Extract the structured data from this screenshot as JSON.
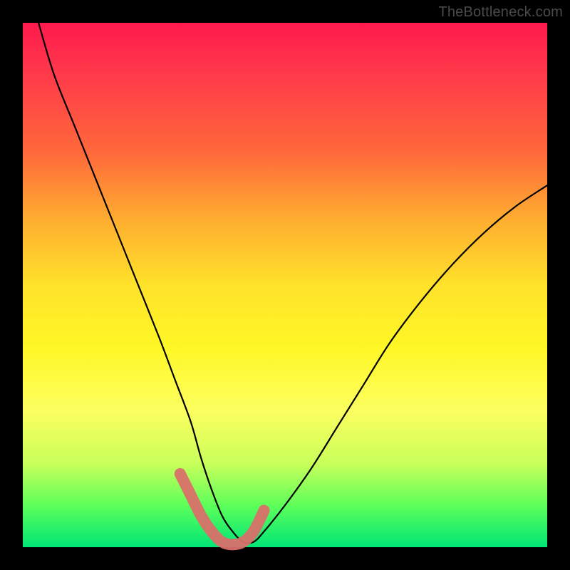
{
  "watermark": "TheBottleneck.com",
  "chart_data": {
    "type": "line",
    "title": "",
    "xlabel": "",
    "ylabel": "",
    "xlim": [
      0,
      100
    ],
    "ylim": [
      0,
      100
    ],
    "series": [
      {
        "name": "bottleneck-curve",
        "x": [
          3,
          6,
          10,
          14,
          18,
          22,
          26,
          29,
          32,
          34,
          36,
          38,
          40,
          42,
          44,
          46,
          50,
          55,
          60,
          65,
          70,
          76,
          82,
          88,
          94,
          100
        ],
        "values": [
          100,
          90,
          80,
          70,
          60,
          50,
          40,
          32,
          24,
          17,
          11,
          6,
          3,
          1,
          1,
          3,
          8,
          15,
          23,
          31,
          39,
          47,
          54,
          60,
          65,
          69
        ]
      }
    ],
    "highlight": {
      "name": "optimal-band",
      "x_range": [
        30,
        46
      ],
      "x": [
        30,
        32,
        34,
        36,
        38,
        40,
        42,
        44,
        46
      ],
      "values": [
        14,
        10,
        6,
        3,
        1,
        0.5,
        1,
        3,
        7
      ]
    }
  }
}
